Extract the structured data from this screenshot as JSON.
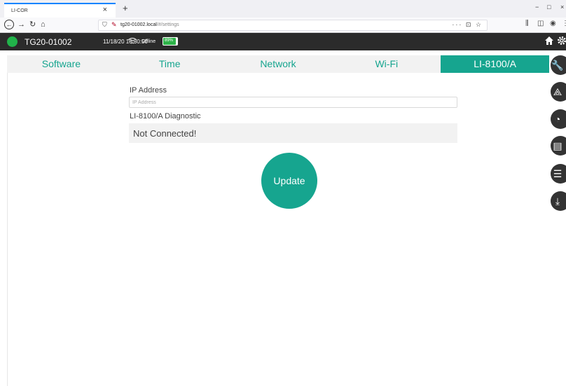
{
  "browser": {
    "tab_title": "LI-COR",
    "tab_close": "×",
    "new_tab": "+",
    "url_host": "tg20-01002.local",
    "url_path": "/#/settings",
    "url_actions": "··· ⊡ ☆",
    "window_controls": [
      "−",
      "□",
      "×"
    ]
  },
  "header": {
    "device_name": "TG20-01002",
    "datetime": "11/18/20 10:30:50",
    "connection_status": "Offline",
    "battery_label": "89%",
    "battery_level": 0.89,
    "status_color": "#21b34a"
  },
  "tabs": [
    {
      "label": "Software",
      "active": false
    },
    {
      "label": "Time",
      "active": false
    },
    {
      "label": "Network",
      "active": false
    },
    {
      "label": "Wi-Fi",
      "active": false
    },
    {
      "label": "LI-8100/A",
      "active": true
    }
  ],
  "form": {
    "ip_label": "IP Address",
    "ip_placeholder": "IP Address",
    "ip_value": "",
    "diagnostic_label": "LI-8100/A Diagnostic",
    "diagnostic_status": "Not Connected!",
    "update_label": "Update"
  },
  "side_buttons": [
    {
      "icon": "wrench-icon",
      "glyph": "🔧"
    },
    {
      "icon": "compass-icon",
      "glyph": "⟁"
    },
    {
      "icon": "gauge-icon",
      "glyph": "◔"
    },
    {
      "icon": "layout-icon",
      "glyph": "▤"
    },
    {
      "icon": "sliders-icon",
      "glyph": "☰"
    },
    {
      "icon": "download-icon",
      "glyph": "⤓"
    }
  ],
  "colors": {
    "accent": "#16a58f",
    "header_bg": "#2b2b2b"
  }
}
